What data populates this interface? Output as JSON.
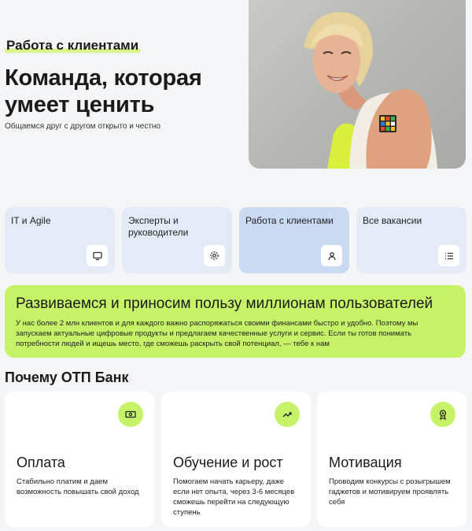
{
  "hero": {
    "eyebrow": "Работа с клиентами",
    "title": "Команда, которая умеет ценить",
    "subtitle": "Общаемся друг с другом открыто и честно"
  },
  "categories": [
    {
      "label": "IT и Agile",
      "icon": "monitor-icon"
    },
    {
      "label": "Эксперты и руководители",
      "icon": "gear-icon"
    },
    {
      "label": "Работа с клиентами",
      "icon": "person-icon",
      "active": true
    },
    {
      "label": "Все вакансии",
      "icon": "list-icon"
    }
  ],
  "banner": {
    "title": "Развиваемся и приносим пользу миллионам пользователей",
    "text": "У нас более 2 млн клиентов и для каждого важно распоряжаться своими финансами быстро и удобно. Поэтому мы запускаем актуальные цифровые продукты и предлагаем качественные услуги и сервис. Если ты готов понимать потребности людей и ищешь место, где сможешь раскрыть свой потенциал, — тебе к нам"
  },
  "why": {
    "title": "Почему ОТП Банк",
    "cards": [
      {
        "title": "Оплата",
        "text": "Стабильно платим и даем возможность повышать свой доход",
        "icon": "money-icon"
      },
      {
        "title": "Обучение и рост",
        "text": "Помогаем начать карьеру, даже если нет опыта, через 3-6 месяцев сможешь перейти на следующую ступень",
        "icon": "trend-up-icon"
      },
      {
        "title": "Мотивация",
        "text": "Проводим конкурсы с розыгрышем гаджетов и мотивируем проявлять себя",
        "icon": "medal-icon"
      }
    ]
  },
  "colors": {
    "accent": "#c6f268",
    "card_blue": "#e4ebf7",
    "card_active": "#cbdaf3",
    "background": "#f3f5f7"
  }
}
